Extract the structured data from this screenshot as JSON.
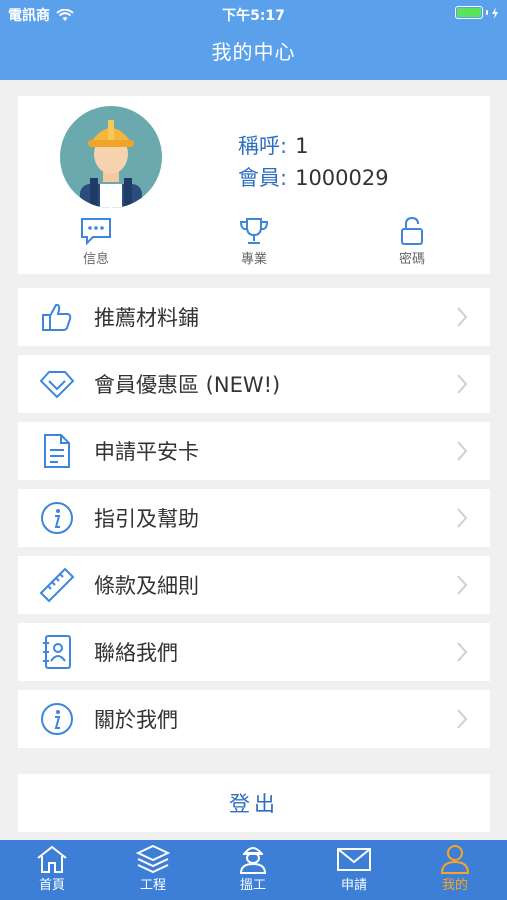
{
  "status": {
    "carrier": "電訊商",
    "time": "下午5:17"
  },
  "header": {
    "title": "我的中心"
  },
  "profile": {
    "nickname_label": "稱呼:",
    "nickname_value": "1",
    "member_label": "會員:",
    "member_value": "1000029",
    "quick": [
      {
        "label": "信息",
        "icon": "message-icon"
      },
      {
        "label": "專業",
        "icon": "trophy-icon"
      },
      {
        "label": "密碼",
        "icon": "unlock-icon"
      }
    ]
  },
  "menu": [
    {
      "label": "推薦材料鋪",
      "icon": "thumbs-up-icon"
    },
    {
      "label": "會員優惠區 (NEW!)",
      "icon": "diamond-icon"
    },
    {
      "label": "申請平安卡",
      "icon": "document-icon"
    },
    {
      "label": "指引及幫助",
      "icon": "info-icon"
    },
    {
      "label": "條款及細則",
      "icon": "ruler-icon"
    },
    {
      "label": "聯絡我們",
      "icon": "contacts-icon"
    },
    {
      "label": "關於我們",
      "icon": "info-icon"
    }
  ],
  "logout": {
    "label": "登出"
  },
  "tabs": [
    {
      "label": "首頁",
      "icon": "home-icon"
    },
    {
      "label": "工程",
      "icon": "layers-icon"
    },
    {
      "label": "搵工",
      "icon": "worker-icon"
    },
    {
      "label": "申請",
      "icon": "mail-icon"
    },
    {
      "label": "我的",
      "icon": "user-icon",
      "active": true
    }
  ],
  "colors": {
    "nav": "#5aa0ea",
    "tabbar": "#3d7fd6",
    "accent": "#2f6fbf",
    "active_tab": "#f6a623"
  }
}
